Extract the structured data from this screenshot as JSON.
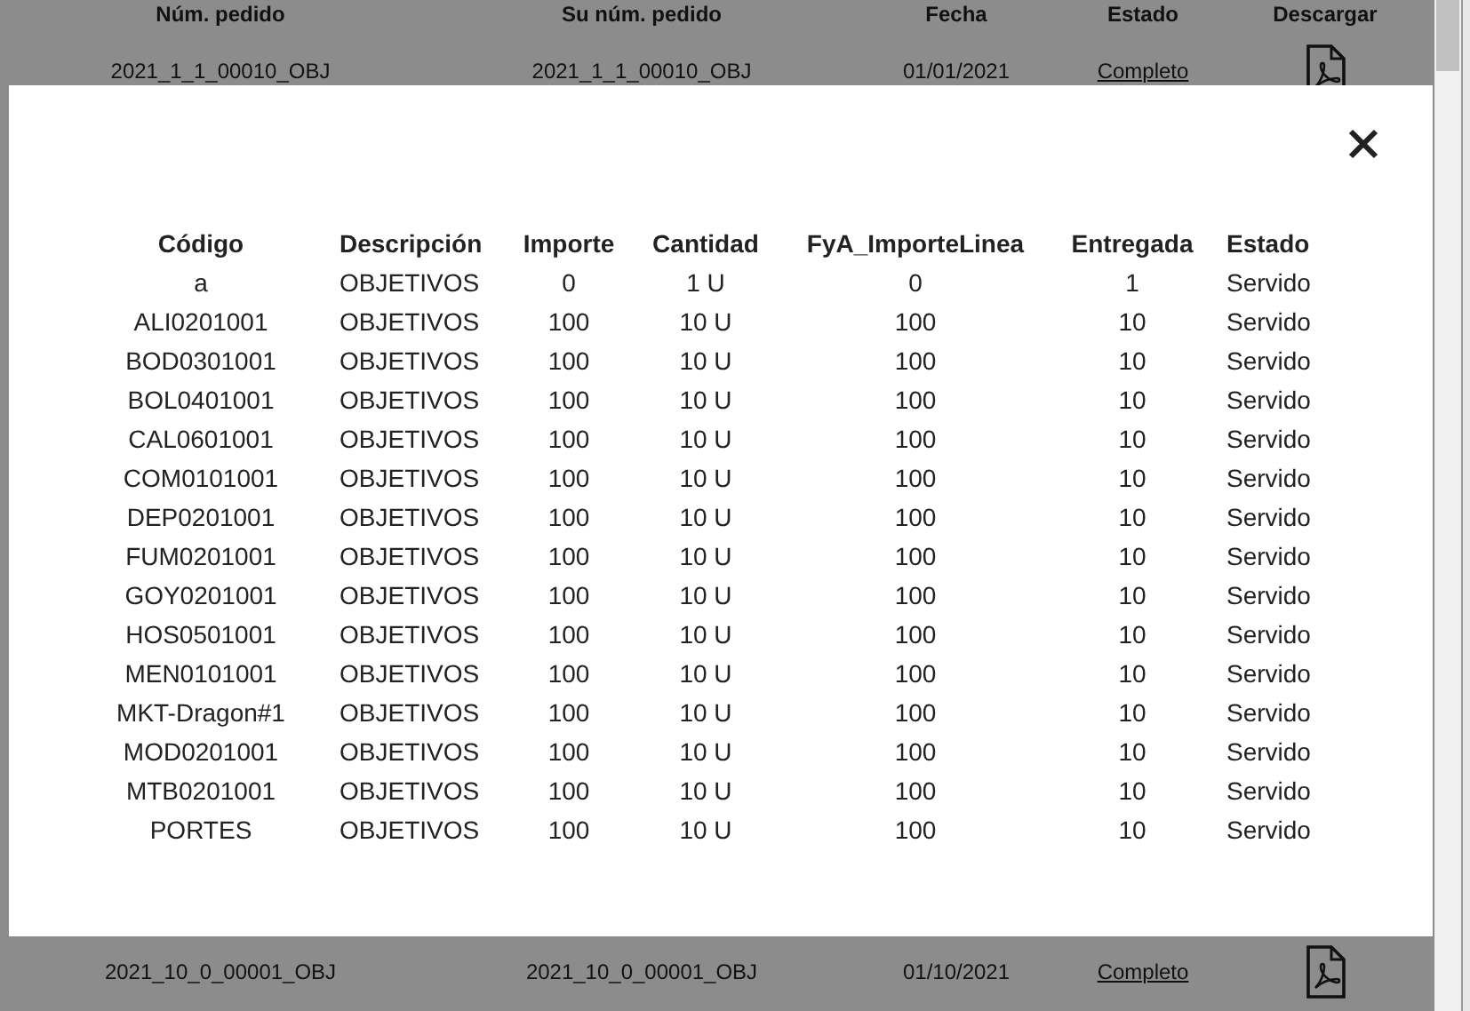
{
  "background_table": {
    "columns": [
      "Núm. pedido",
      "Su núm. pedido",
      "Fecha",
      "Estado",
      "Descargar"
    ],
    "rows": [
      {
        "cells": [
          "2021_1_1_00010_OBJ",
          "2021_1_1_00010_OBJ",
          "01/01/2021",
          "Completo"
        ]
      },
      {
        "cells": [
          "2021_10_0_00001_OBJ",
          "2021_10_0_00001_OBJ",
          "01/10/2021",
          "Completo"
        ]
      }
    ]
  },
  "modal": {
    "table": {
      "columns": [
        "Código",
        "Descripción",
        "Importe",
        "Cantidad",
        "FyA_ImporteLinea",
        "Entregada",
        "Estado"
      ],
      "rows": [
        [
          "a",
          "OBJETIVOS",
          "0",
          "1 U",
          "0",
          "1",
          "Servido"
        ],
        [
          "ALI0201001",
          "OBJETIVOS",
          "100",
          "10 U",
          "100",
          "10",
          "Servido"
        ],
        [
          "BOD0301001",
          "OBJETIVOS",
          "100",
          "10 U",
          "100",
          "10",
          "Servido"
        ],
        [
          "BOL0401001",
          "OBJETIVOS",
          "100",
          "10 U",
          "100",
          "10",
          "Servido"
        ],
        [
          "CAL0601001",
          "OBJETIVOS",
          "100",
          "10 U",
          "100",
          "10",
          "Servido"
        ],
        [
          "COM0101001",
          "OBJETIVOS",
          "100",
          "10 U",
          "100",
          "10",
          "Servido"
        ],
        [
          "DEP0201001",
          "OBJETIVOS",
          "100",
          "10 U",
          "100",
          "10",
          "Servido"
        ],
        [
          "FUM0201001",
          "OBJETIVOS",
          "100",
          "10 U",
          "100",
          "10",
          "Servido"
        ],
        [
          "GOY0201001",
          "OBJETIVOS",
          "100",
          "10 U",
          "100",
          "10",
          "Servido"
        ],
        [
          "HOS0501001",
          "OBJETIVOS",
          "100",
          "10 U",
          "100",
          "10",
          "Servido"
        ],
        [
          "MEN0101001",
          "OBJETIVOS",
          "100",
          "10 U",
          "100",
          "10",
          "Servido"
        ],
        [
          "MKT-Dragon#1",
          "OBJETIVOS",
          "100",
          "10 U",
          "100",
          "10",
          "Servido"
        ],
        [
          "MOD0201001",
          "OBJETIVOS",
          "100",
          "10 U",
          "100",
          "10",
          "Servido"
        ],
        [
          "MTB0201001",
          "OBJETIVOS",
          "100",
          "10 U",
          "100",
          "10",
          "Servido"
        ],
        [
          "PORTES",
          "OBJETIVOS",
          "100",
          "10 U",
          "100",
          "10",
          "Servido"
        ]
      ]
    }
  }
}
